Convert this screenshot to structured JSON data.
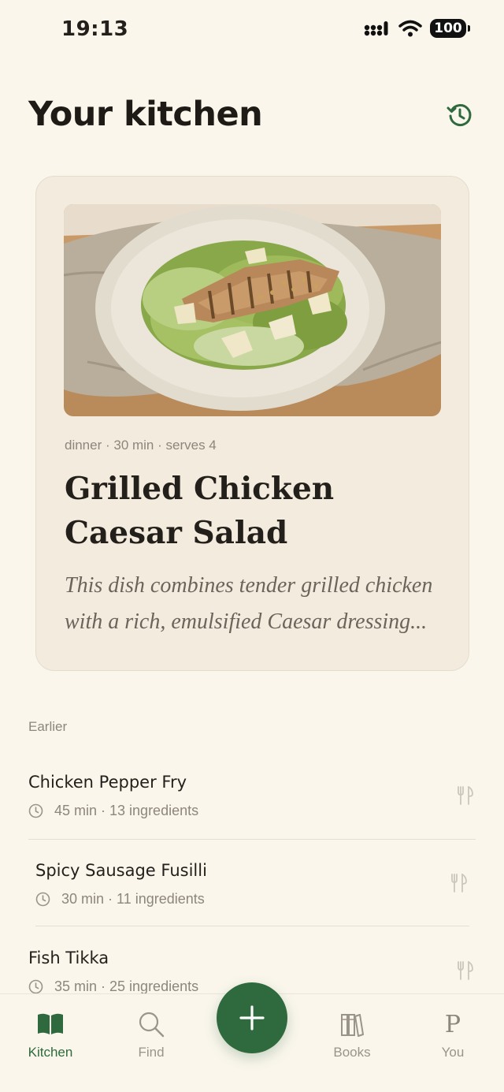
{
  "status_bar": {
    "time": "19:13",
    "battery": "100"
  },
  "header": {
    "title": "Your kitchen"
  },
  "featured": {
    "meta": "dinner · 30 min · serves 4",
    "title": "Grilled Chicken Caesar Salad",
    "description": "This dish combines tender grilled chicken with a rich, emulsified Caesar dressing..."
  },
  "earlier": {
    "label": "Earlier",
    "items": [
      {
        "title": "Chicken Pepper Fry",
        "meta": "45 min · 13 ingredients"
      },
      {
        "title": "Spicy Sausage Fusilli",
        "meta": "30 min · 11 ingredients"
      },
      {
        "title": "Fish Tikka",
        "meta": "35 min · 25 ingredients"
      }
    ]
  },
  "tabs": [
    {
      "label": "Kitchen",
      "icon": "book-open-icon",
      "active": true
    },
    {
      "label": "Find",
      "icon": "search-icon",
      "active": false
    },
    {
      "label": "Books",
      "icon": "books-icon",
      "active": false
    },
    {
      "label": "You",
      "icon": "profile-initial-icon",
      "glyph": "P",
      "active": false
    }
  ],
  "colors": {
    "background": "#faf6ec",
    "accent": "#2f6a3e",
    "card": "#f3ebdd"
  }
}
